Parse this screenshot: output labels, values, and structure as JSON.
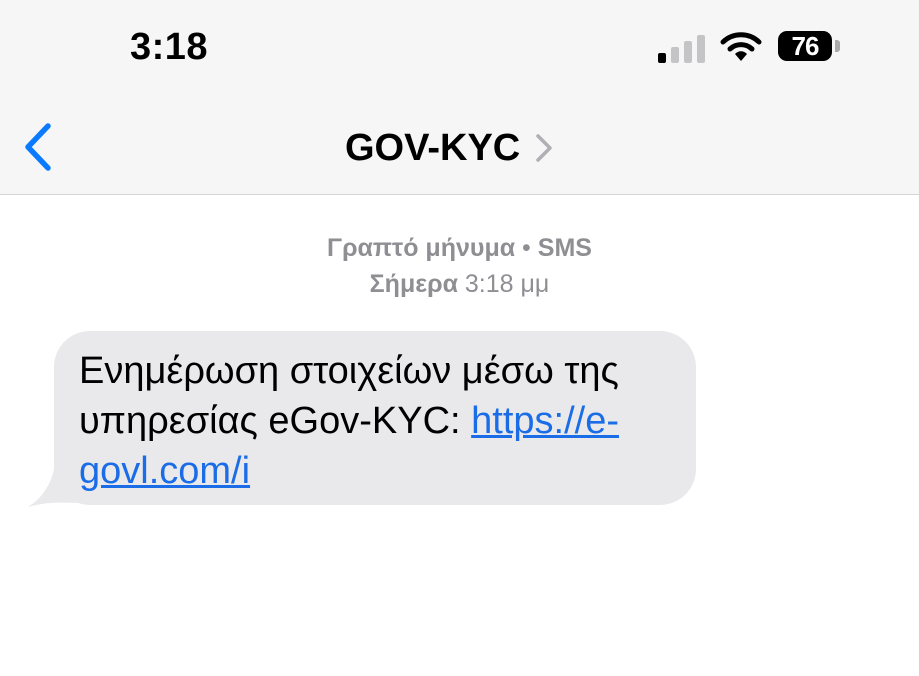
{
  "status_bar": {
    "time": "3:18",
    "battery": "76",
    "icons": [
      "cellular-signal-icon",
      "wifi-icon",
      "battery-icon"
    ]
  },
  "nav": {
    "back_icon": "chevron-left-icon",
    "contact_name": "GOV-KYC",
    "contact_chevron_icon": "chevron-right-icon"
  },
  "thread": {
    "message_type_prefix": "Γραπτό μήνυμα",
    "separator": " • ",
    "message_type_suffix": "SMS",
    "date_label": "Σήμερα",
    "time": " 3:18 μμ"
  },
  "message": {
    "text_line1": "Ενημέρωση στοιχείων μέσω της",
    "text_line2": "υπηρεσίας eGov-KYC: ",
    "link_part1": "https://e-",
    "link_part2": "govl.com/i"
  },
  "colors": {
    "link": "#1a6de6",
    "bubble": "#e9e9eb",
    "header_bg": "#f6f6f6",
    "accent": "#0a7aff"
  }
}
